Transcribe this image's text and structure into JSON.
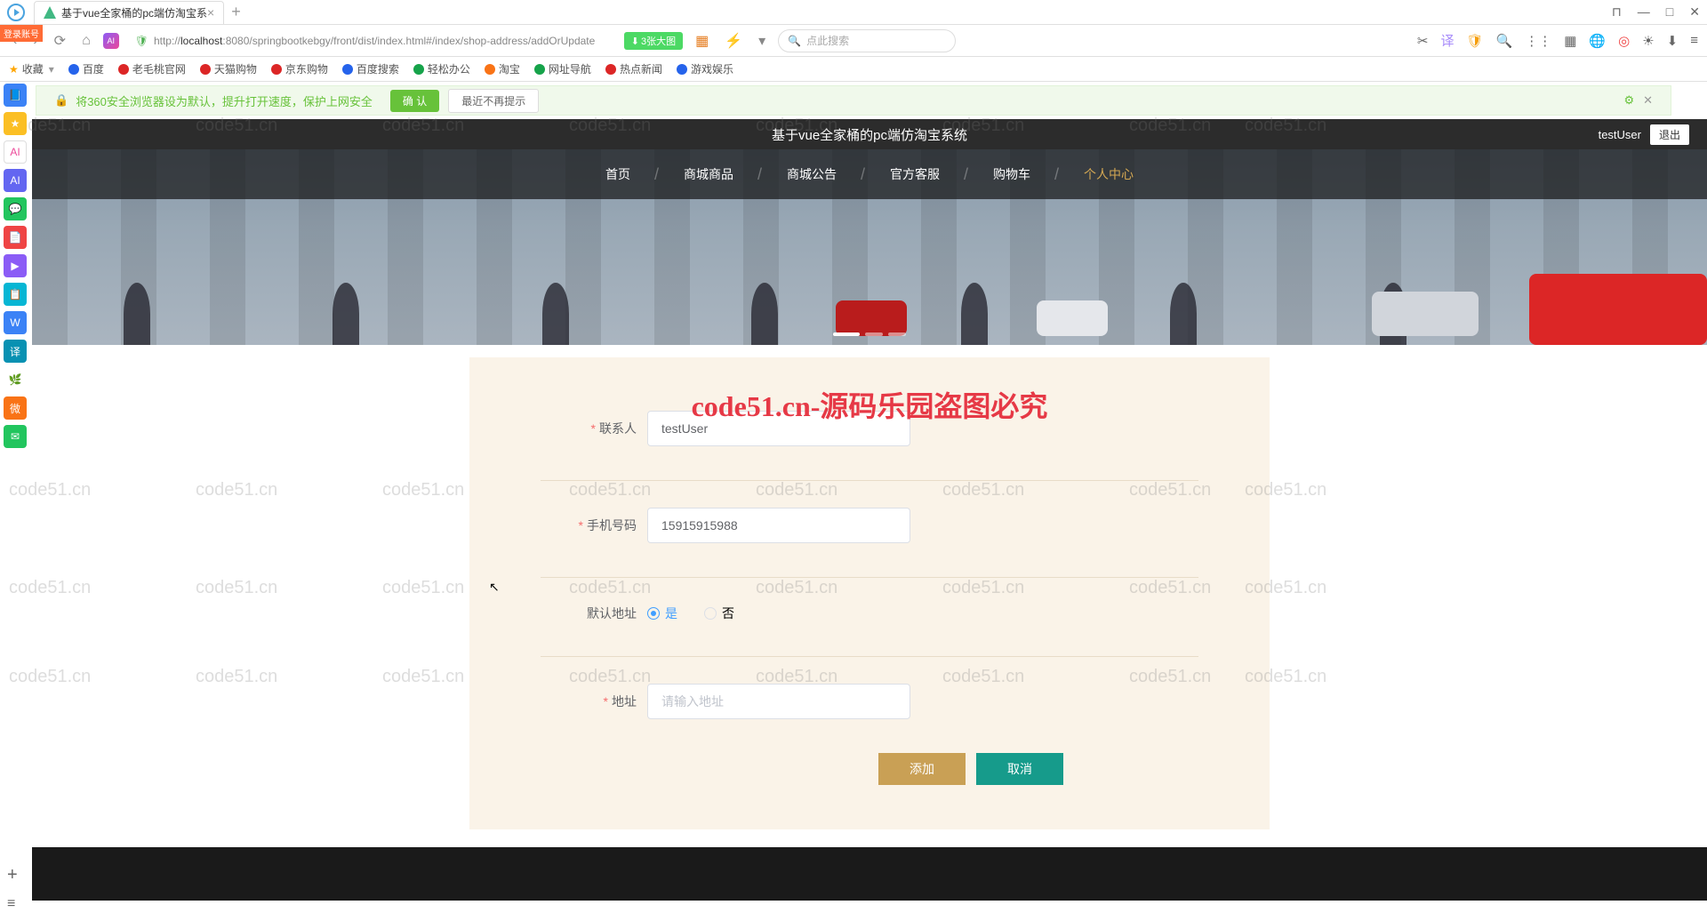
{
  "browser": {
    "tab_title": "基于vue全家桶的pc端仿淘宝系",
    "url_prefix": "http://",
    "url_host": "localhost",
    "url_port": ":8080",
    "url_path": "/springbootkebgy/front/dist/index.html#/index/shop-address/addOrUpdate",
    "badge": "3张大图",
    "search_placeholder": "点此搜索",
    "win": {
      "pin": "⊓",
      "min": "—",
      "max": "□",
      "close": "✕"
    }
  },
  "bookmarks": {
    "fav": "收藏",
    "items": [
      "百度",
      "老毛桃官网",
      "天猫购物",
      "京东购物",
      "百度搜索",
      "轻松办公",
      "淘宝",
      "网址导航",
      "热点新闻",
      "游戏娱乐"
    ]
  },
  "notice": {
    "text": "将360安全浏览器设为默认，提升打开速度，保护上网安全",
    "confirm": "确 认",
    "later": "最近不再提示"
  },
  "sidebar_badge": "登录账号",
  "header": {
    "title": "基于vue全家桶的pc端仿淘宝系统",
    "user": "testUser",
    "logout": "退出"
  },
  "nav": [
    "首页",
    "商城商品",
    "商城公告",
    "官方客服",
    "购物车",
    "个人中心"
  ],
  "nav_active_index": 5,
  "watermark_big": "code51.cn-源码乐园盗图必究",
  "watermark_small": "code51.cn",
  "form": {
    "contact_label": "联系人",
    "contact_value": "testUser",
    "phone_label": "手机号码",
    "phone_value": "15915915988",
    "default_label": "默认地址",
    "radio_yes": "是",
    "radio_no": "否",
    "address_label": "地址",
    "address_placeholder": "请输入地址",
    "btn_add": "添加",
    "btn_cancel": "取消"
  }
}
